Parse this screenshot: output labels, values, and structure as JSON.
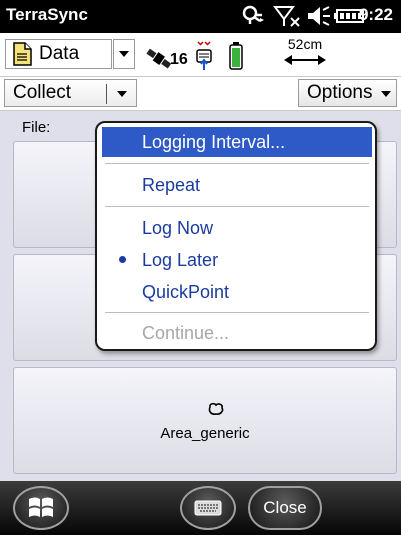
{
  "status": {
    "app_title": "TerraSync",
    "time": "9:22",
    "icons": [
      "sync-icon",
      "no-signal-icon",
      "volume-icon",
      "battery-icon"
    ]
  },
  "toolbar": {
    "section_label": "Data",
    "gnss": {
      "satellite_count": "16",
      "icons": [
        "satellite-icon",
        "receiver-icon",
        "battery-icon"
      ]
    },
    "accuracy": "52cm"
  },
  "subbar": {
    "mode_label": "Collect",
    "options_label": "Options"
  },
  "main": {
    "file_label": "File:",
    "features": [
      "",
      "",
      "Area_generic"
    ]
  },
  "menu": {
    "items": [
      {
        "label": "Logging Interval...",
        "state": "highlighted"
      },
      {
        "label": "Repeat",
        "state": "normal"
      },
      {
        "label": "Log Now",
        "state": "normal"
      },
      {
        "label": "Log Later",
        "state": "selected"
      },
      {
        "label": "QuickPoint",
        "state": "normal"
      },
      {
        "label": "Continue...",
        "state": "disabled"
      }
    ]
  },
  "bottom": {
    "close_label": "Close"
  },
  "colors": {
    "accent": "#2d5ac6",
    "menu_text": "#1a3c9e",
    "disabled_text": "#a7a7a7",
    "background": "#dedfea"
  }
}
